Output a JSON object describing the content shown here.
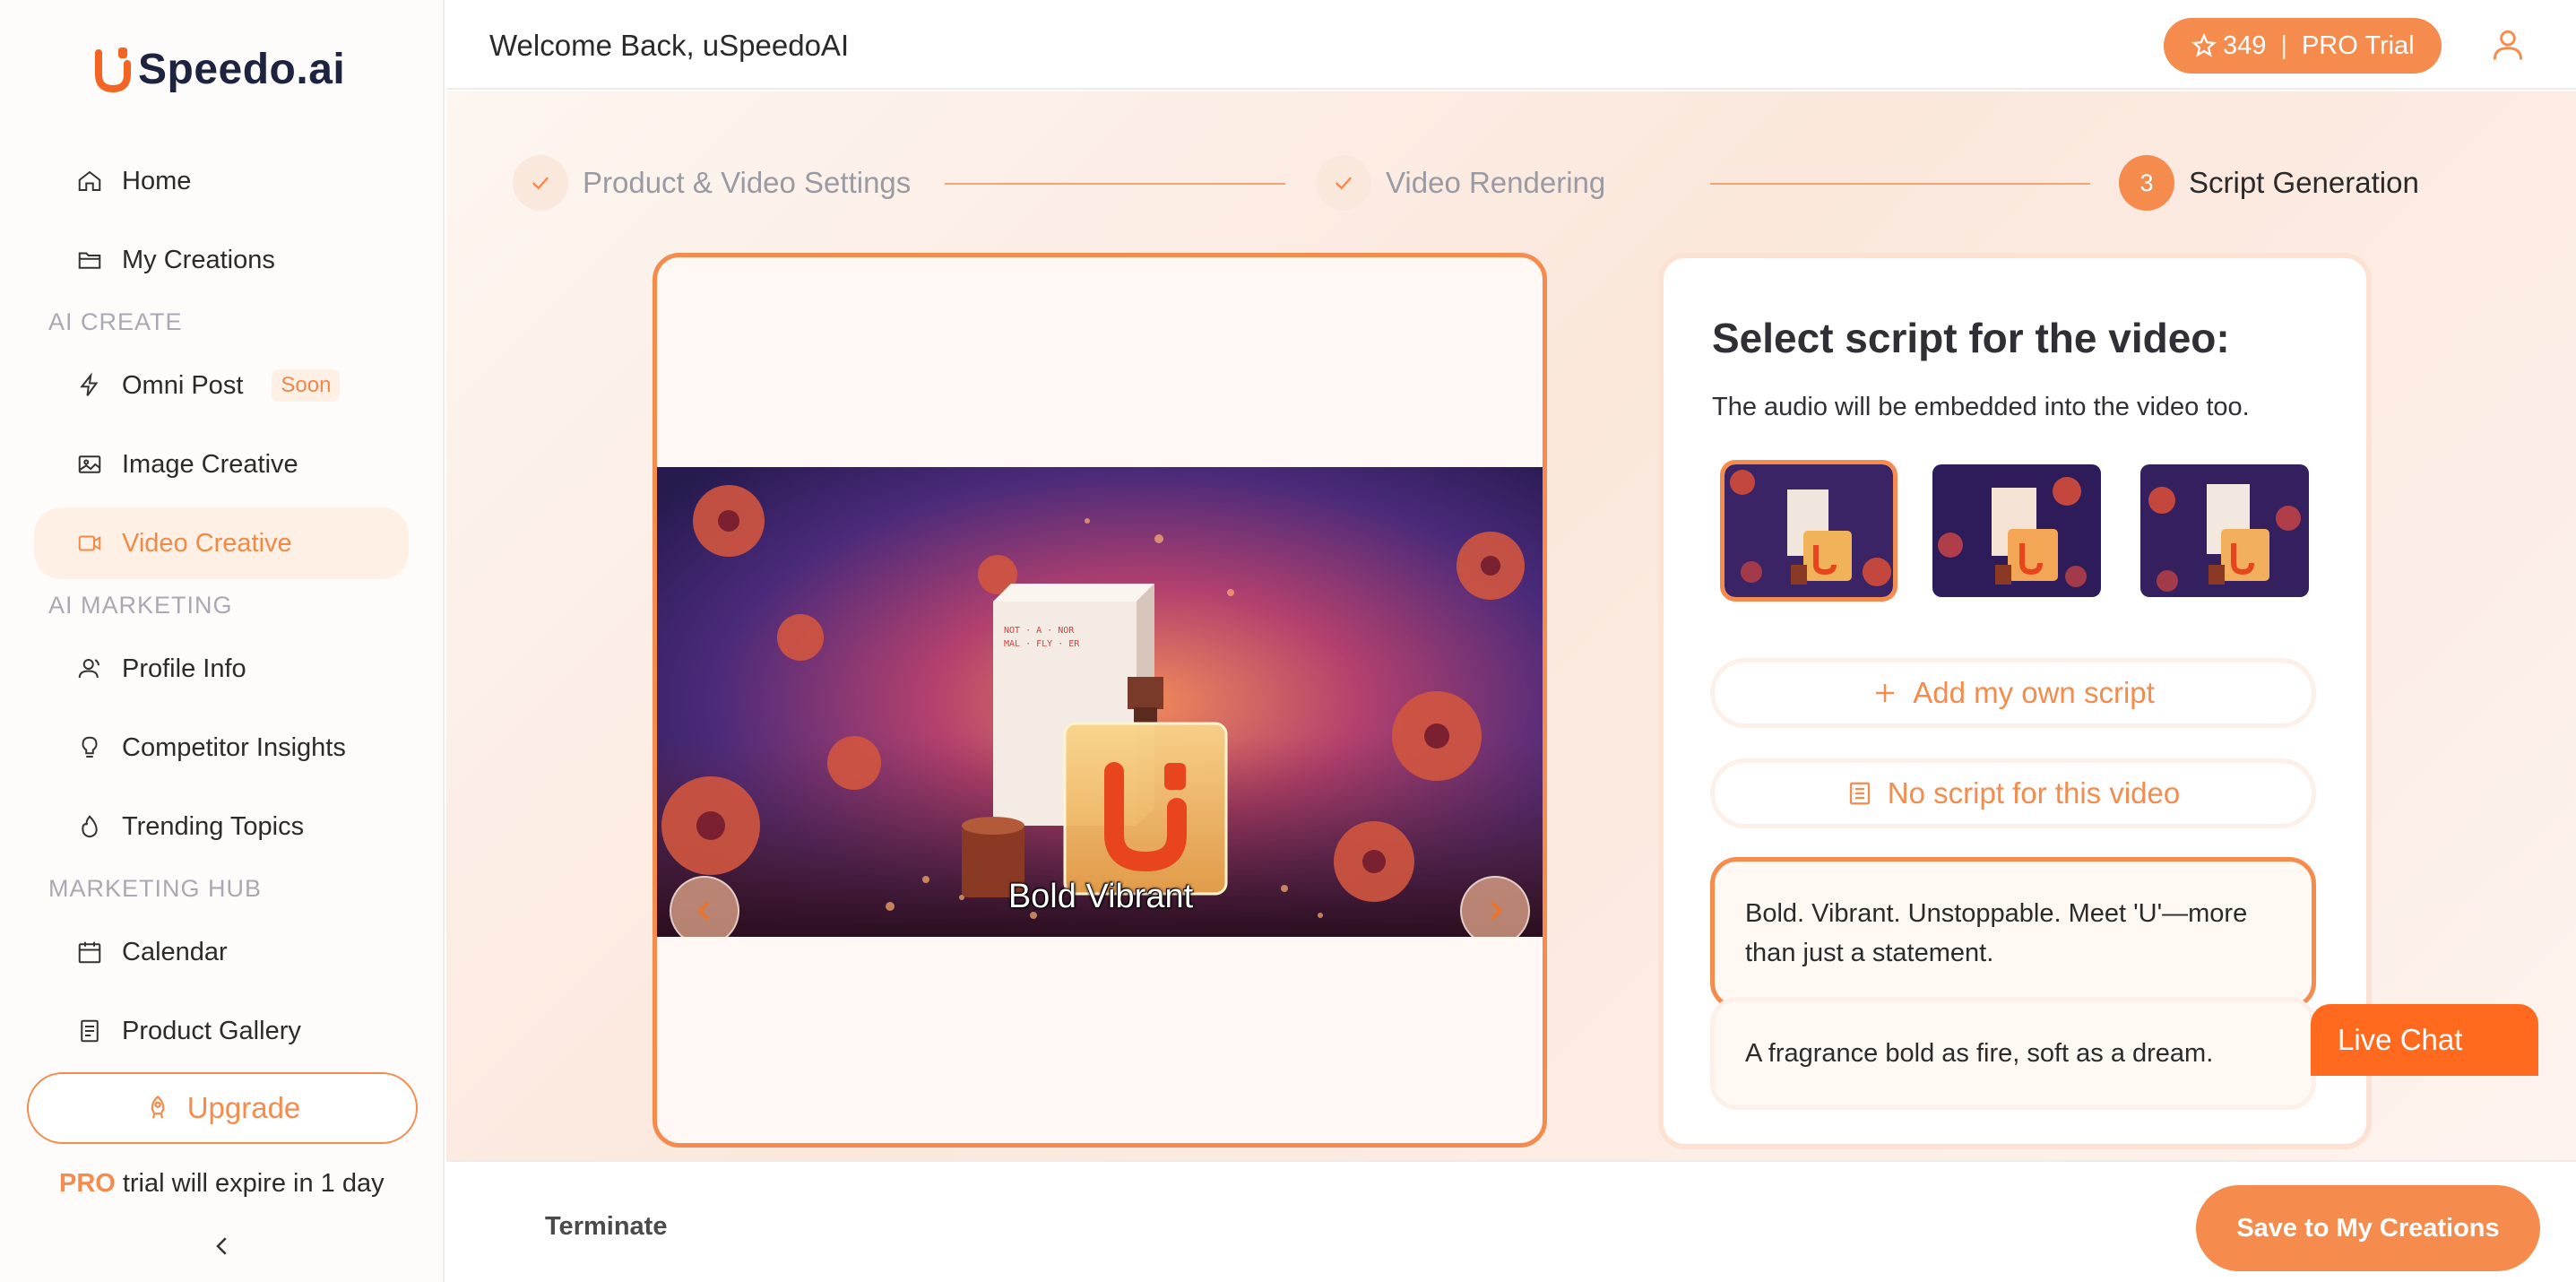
{
  "app": {
    "logo_text": "Speedo.ai",
    "brand_color": "#f58b4c"
  },
  "sidebar": {
    "items": [
      {
        "label": "Home",
        "icon": "home-icon"
      },
      {
        "label": "My Creations",
        "icon": "folder-icon"
      },
      {
        "label": "Omni Post",
        "icon": "lightning-icon",
        "badge": "Soon"
      },
      {
        "label": "Image Creative",
        "icon": "image-icon"
      },
      {
        "label": "Video Creative",
        "icon": "video-icon",
        "active": true
      },
      {
        "label": "Profile Info",
        "icon": "profile-icon"
      },
      {
        "label": "Competitor Insights",
        "icon": "lightbulb-icon"
      },
      {
        "label": "Trending Topics",
        "icon": "flame-icon"
      },
      {
        "label": "Calendar",
        "icon": "calendar-icon"
      },
      {
        "label": "Product Gallery",
        "icon": "gallery-icon"
      }
    ],
    "sections": {
      "ai_create": "AI CREATE",
      "ai_marketing": "AI MARKETING",
      "marketing_hub": "MARKETING HUB"
    },
    "upgrade_label": "Upgrade",
    "trial_pro": "PRO",
    "trial_text": "trial will expire in 1 day"
  },
  "header": {
    "welcome": "Welcome Back, uSpeedoAI",
    "credits": "349",
    "separator": "|",
    "plan": "PRO Trial"
  },
  "steps": [
    {
      "label": "Product & Video Settings",
      "state": "done"
    },
    {
      "label": "Video Rendering",
      "state": "done"
    },
    {
      "number": "3",
      "label": "Script Generation",
      "state": "current"
    }
  ],
  "preview": {
    "caption": "Bold Vibrant",
    "box_text": "NOT · A · NOR · MAL · FLY · ER"
  },
  "script_panel": {
    "title": "Select script for the video:",
    "subtitle": "The audio will be embedded into the video too.",
    "thumbnail_count": 3,
    "selected_thumbnail": 0,
    "add_script_label": "Add my own script",
    "no_script_label": "No script for this video",
    "scripts": [
      {
        "text": "Bold. Vibrant. Unstoppable. Meet 'U'—more than just a statement.",
        "selected": true
      },
      {
        "text": "A fragrance bold as fire, soft as a dream.",
        "selected": false
      }
    ]
  },
  "live_chat_label": "Live Chat",
  "footer": {
    "terminate_label": "Terminate",
    "save_label": "Save to My Creations"
  }
}
